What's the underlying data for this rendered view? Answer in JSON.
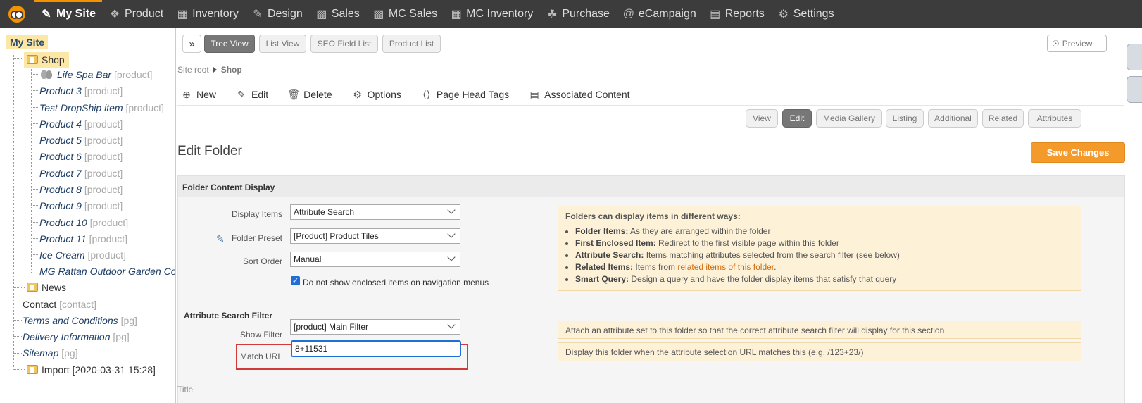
{
  "nav": {
    "items": [
      {
        "label": "My Site",
        "icon": "site-icon"
      },
      {
        "label": "Product",
        "icon": "product-icon"
      },
      {
        "label": "Inventory",
        "icon": "inventory-icon"
      },
      {
        "label": "Design",
        "icon": "design-icon"
      },
      {
        "label": "Sales",
        "icon": "sales-icon"
      },
      {
        "label": "MC Sales",
        "icon": "mc-sales-icon"
      },
      {
        "label": "MC Inventory",
        "icon": "mc-inventory-icon"
      },
      {
        "label": "Purchase",
        "icon": "purchase-icon"
      },
      {
        "label": "eCampaign",
        "icon": "ecampaign-icon"
      },
      {
        "label": "Reports",
        "icon": "reports-icon"
      },
      {
        "label": "Settings",
        "icon": "settings-icon"
      }
    ],
    "active": "My Site",
    "accent": "#f39200"
  },
  "tree": {
    "root": "My Site",
    "shop": "Shop",
    "shop_children": [
      {
        "label": "Life Spa Bar",
        "tag": "[product]"
      },
      {
        "label": "Product 3",
        "tag": "[product]"
      },
      {
        "label": "Test DropShip item",
        "tag": "[product]"
      },
      {
        "label": "Product 4",
        "tag": "[product]"
      },
      {
        "label": "Product 5",
        "tag": "[product]"
      },
      {
        "label": "Product 6",
        "tag": "[product]"
      },
      {
        "label": "Product 7",
        "tag": "[product]"
      },
      {
        "label": "Product 8",
        "tag": "[product]"
      },
      {
        "label": "Product 9",
        "tag": "[product]"
      },
      {
        "label": "Product 10",
        "tag": "[product]"
      },
      {
        "label": "Product 11",
        "tag": "[product]"
      },
      {
        "label": "Ice Cream",
        "tag": "[product]"
      },
      {
        "label": "MG Rattan Outdoor Garden Corr",
        "tag": ""
      }
    ],
    "news": "News",
    "pages": [
      {
        "label": "Contact",
        "tag": "[contact]"
      },
      {
        "label": "Terms and Conditions",
        "tag": "[pg]"
      },
      {
        "label": "Delivery Information",
        "tag": "[pg]"
      },
      {
        "label": "Sitemap",
        "tag": "[pg]"
      }
    ],
    "import": "Import [2020-03-31 15:28]"
  },
  "toolbar": {
    "views": [
      "Tree View",
      "List View",
      "SEO Field List",
      "Product List"
    ],
    "active_view": "Tree View",
    "preview": "Preview"
  },
  "breadcrumb": {
    "root": "Site root",
    "current": "Shop"
  },
  "actions": [
    {
      "label": "New",
      "icon": "plus-circle-icon"
    },
    {
      "label": "Edit",
      "icon": "pencil-icon"
    },
    {
      "label": "Delete",
      "icon": "trash-icon"
    },
    {
      "label": "Options",
      "icon": "gear-icon"
    },
    {
      "label": "Page Head Tags",
      "icon": "code-icon"
    },
    {
      "label": "Associated Content",
      "icon": "list-icon"
    }
  ],
  "tabs": [
    "View",
    "Edit",
    "Media Gallery",
    "Listing",
    "Additional",
    "Related",
    "Attributes"
  ],
  "active_tab": "Edit",
  "page": {
    "title": "Edit Folder",
    "save": "Save Changes"
  },
  "form": {
    "section": "Folder Content Display",
    "display_items_label": "Display Items",
    "display_items_value": "Attribute Search",
    "folder_preset_label": "Folder Preset",
    "folder_preset_value": "[Product] Product Tiles",
    "sort_order_label": "Sort Order",
    "sort_order_value": "Manual",
    "nav_checkbox_label": "Do not show enclosed items on navigation menus",
    "nav_checkbox_checked": true,
    "filter_section": "Attribute Search Filter",
    "show_filter_label": "Show Filter",
    "show_filter_value": "[product] Main Filter",
    "match_url_label": "Match URL",
    "match_url_value": "8+11531",
    "title_label": "Title"
  },
  "help": {
    "title": "Folders can display items in different ways:",
    "items": [
      {
        "term": "Folder Items:",
        "text": "As they are arranged within the folder"
      },
      {
        "term": "First Enclosed Item:",
        "text": "Redirect to the first visible page within this folder"
      },
      {
        "term": "Attribute Search:",
        "text": "Items matching attributes selected from the search filter (see below)"
      },
      {
        "term": "Related Items:",
        "text": "Items from",
        "link": "related items of this folder",
        "after": "."
      },
      {
        "term": "Smart Query:",
        "text": "Design a query and have the folder display items that satisfy that query"
      }
    ],
    "filter_help": "Attach an attribute set to this folder so that the correct attribute search filter will display for this section",
    "url_help": "Display this folder when the attribute selection URL matches this (e.g. /123+23/)"
  }
}
